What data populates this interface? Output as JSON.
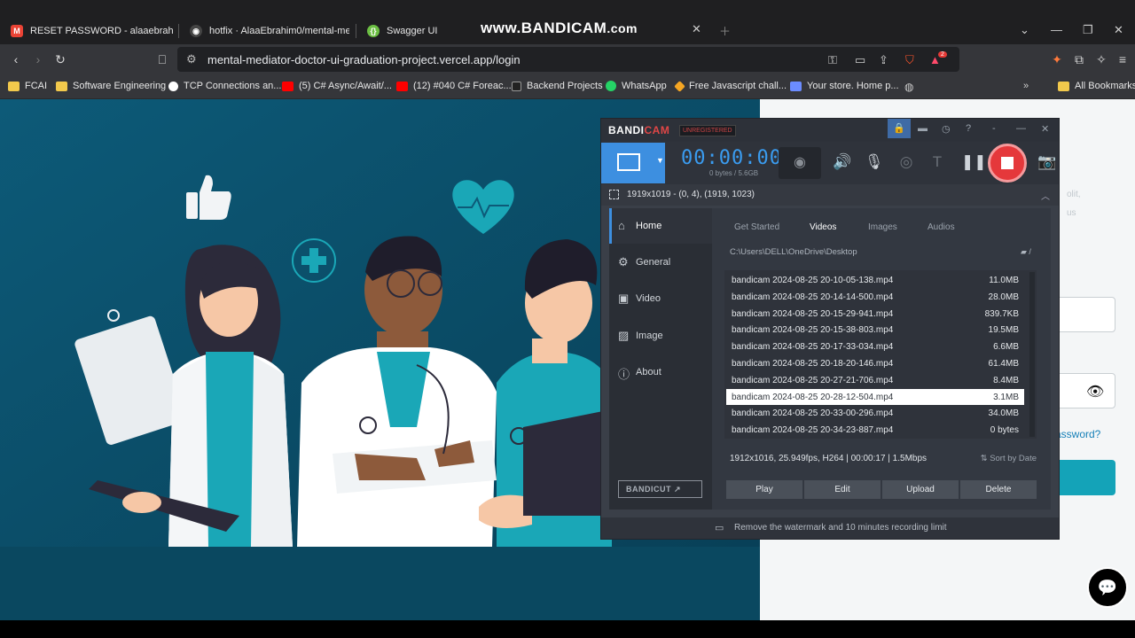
{
  "browser": {
    "tabs": [
      {
        "label": "RESET PASSWORD - alaaebrahim38",
        "favicon": "gmail-icon",
        "favicon_letter": "M",
        "favicon_color": "#ea4335"
      },
      {
        "label": "hotfix · AlaaEbrahim0/mental-media",
        "favicon": "github-icon",
        "favicon_letter": "◉",
        "favicon_color": "#444444"
      },
      {
        "label": "Swagger UI",
        "favicon": "swagger-icon",
        "favicon_letter": "{}",
        "favicon_color": "#6cbf43"
      }
    ],
    "watermark": {
      "main": "www.BANDICAM",
      "suffix": ".com"
    },
    "url": "mental-mediator-doctor-ui-graduation-project.vercel.app/login",
    "bookmarks": [
      {
        "label": "FCAI",
        "icon": "folder-icon"
      },
      {
        "label": "Software Engineering",
        "icon": "folder-icon"
      },
      {
        "label": "TCP Connections an...",
        "icon": "site-icon"
      },
      {
        "label": "(5) C# Async/Await/...",
        "icon": "youtube-icon"
      },
      {
        "label": "(12) #040 C# Foreac...",
        "icon": "youtube-icon"
      },
      {
        "label": "Backend Projects",
        "icon": "site-icon"
      },
      {
        "label": "WhatsApp",
        "icon": "whatsapp-icon"
      },
      {
        "label": "Free Javascript chall...",
        "icon": "site-icon"
      },
      {
        "label": "Your store. Home p...",
        "icon": "site-icon"
      }
    ],
    "all_bookmarks": "All Bookmarks",
    "badge_count": "2"
  },
  "login": {
    "forgot_suffix": "assword?",
    "faint1": "olit,",
    "faint2": "us"
  },
  "bandicam": {
    "logo_main": "BANDI",
    "logo_accent": "CAM",
    "unregistered": "UNREGISTERED",
    "timer": "00:00:00",
    "bytes": "0 bytes / 5.6GB",
    "region": "1919x1019 - (0, 4), (1919, 1023)",
    "sidebar": [
      {
        "label": "Home",
        "icon": "home-icon"
      },
      {
        "label": "General",
        "icon": "gear-icon"
      },
      {
        "label": "Video",
        "icon": "video-icon"
      },
      {
        "label": "Image",
        "icon": "image-icon"
      },
      {
        "label": "About",
        "icon": "info-icon"
      }
    ],
    "bandicut": "BANDICUT ↗",
    "tabs": [
      "Get Started",
      "Videos",
      "Images",
      "Audios"
    ],
    "path": "C:\\Users\\DELL\\OneDrive\\Desktop",
    "files": [
      {
        "name": "bandicam 2024-08-25 20-10-05-138.mp4",
        "size": "11.0MB"
      },
      {
        "name": "bandicam 2024-08-25 20-14-14-500.mp4",
        "size": "28.0MB"
      },
      {
        "name": "bandicam 2024-08-25 20-15-29-941.mp4",
        "size": "839.7KB"
      },
      {
        "name": "bandicam 2024-08-25 20-15-38-803.mp4",
        "size": "19.5MB"
      },
      {
        "name": "bandicam 2024-08-25 20-17-33-034.mp4",
        "size": "6.6MB"
      },
      {
        "name": "bandicam 2024-08-25 20-18-20-146.mp4",
        "size": "61.4MB"
      },
      {
        "name": "bandicam 2024-08-25 20-27-21-706.mp4",
        "size": "8.4MB"
      },
      {
        "name": "bandicam 2024-08-25 20-28-12-504.mp4",
        "size": "3.1MB"
      },
      {
        "name": "bandicam 2024-08-25 20-33-00-296.mp4",
        "size": "34.0MB"
      },
      {
        "name": "bandicam 2024-08-25 20-34-23-887.mp4",
        "size": "0 bytes"
      }
    ],
    "selected_index": 7,
    "info": "1912x1016, 25.949fps, H264 | 00:00:17 | 1.5Mbps",
    "sort": "Sort by Date",
    "buttons": [
      "Play",
      "Edit",
      "Upload",
      "Delete"
    ],
    "footer": "Remove the watermark and 10 minutes recording limit"
  }
}
